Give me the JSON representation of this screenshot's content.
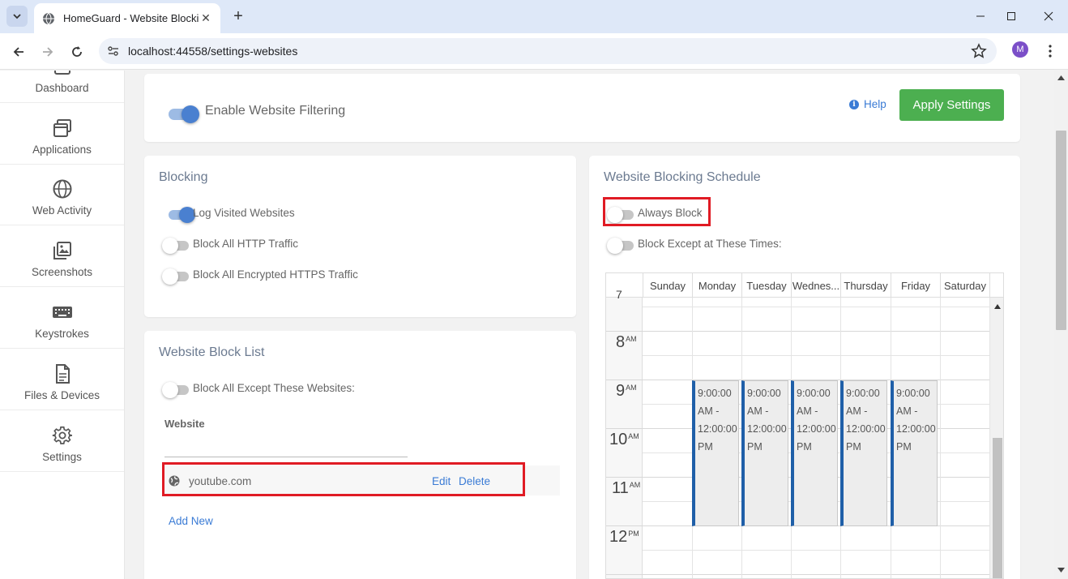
{
  "browser": {
    "tab_title": "HomeGuard - Website Blocking",
    "url": "localhost:44558/settings-websites",
    "profile_initial": "M"
  },
  "sidebar": {
    "items": [
      {
        "label": "Dashboard",
        "icon": "dashboard-icon"
      },
      {
        "label": "Applications",
        "icon": "applications-icon"
      },
      {
        "label": "Web Activity",
        "icon": "globe-icon"
      },
      {
        "label": "Screenshots",
        "icon": "screenshots-icon"
      },
      {
        "label": "Keystrokes",
        "icon": "keyboard-icon"
      },
      {
        "label": "Files & Devices",
        "icon": "file-icon"
      },
      {
        "label": "Settings",
        "icon": "gear-icon"
      }
    ]
  },
  "header": {
    "enable_filtering_label": "Enable Website Filtering",
    "enable_filtering_on": true,
    "help_label": "Help",
    "apply_label": "Apply Settings"
  },
  "blocking": {
    "title": "Blocking",
    "options": [
      {
        "label": "Log Visited Websites",
        "on": true
      },
      {
        "label": "Block All HTTP Traffic",
        "on": false
      },
      {
        "label": "Block All Encrypted HTTPS Traffic",
        "on": false
      }
    ]
  },
  "blocklist": {
    "title": "Website Block List",
    "except_label": "Block All Except These Websites:",
    "except_on": false,
    "column_label": "Website",
    "sites": [
      {
        "name": "youtube.com",
        "edit": "Edit",
        "delete": "Delete"
      }
    ],
    "add_new_label": "Add New"
  },
  "schedule": {
    "title": "Website Blocking Schedule",
    "always_block_label": "Always Block",
    "always_block_on": false,
    "except_times_label": "Block Except at These Times:",
    "except_times_on": false,
    "days": [
      "Sunday",
      "Monday",
      "Tuesday",
      "Wednes...",
      "Thursday",
      "Friday",
      "Saturday"
    ],
    "hours": [
      {
        "num": "8",
        "ampm": "AM"
      },
      {
        "num": "9",
        "ampm": "AM"
      },
      {
        "num": "10",
        "ampm": "AM"
      },
      {
        "num": "11",
        "ampm": "AM"
      },
      {
        "num": "12",
        "ampm": "PM"
      }
    ],
    "events": [
      {
        "day": "Monday",
        "text": [
          "9:00:00",
          "AM -",
          "12:00:00",
          "PM"
        ]
      },
      {
        "day": "Tuesday",
        "text": [
          "9:00:00",
          "AM -",
          "12:00:00",
          "PM"
        ]
      },
      {
        "day": "Wednesday",
        "text": [
          "9:00:00",
          "AM -",
          "12:00:00",
          "PM"
        ]
      },
      {
        "day": "Thursday",
        "text": [
          "9:00:00",
          "AM -",
          "12:00:00",
          "PM"
        ]
      },
      {
        "day": "Friday",
        "text": [
          "9:00:00",
          "AM -",
          "12:00:00",
          "PM"
        ]
      }
    ]
  }
}
